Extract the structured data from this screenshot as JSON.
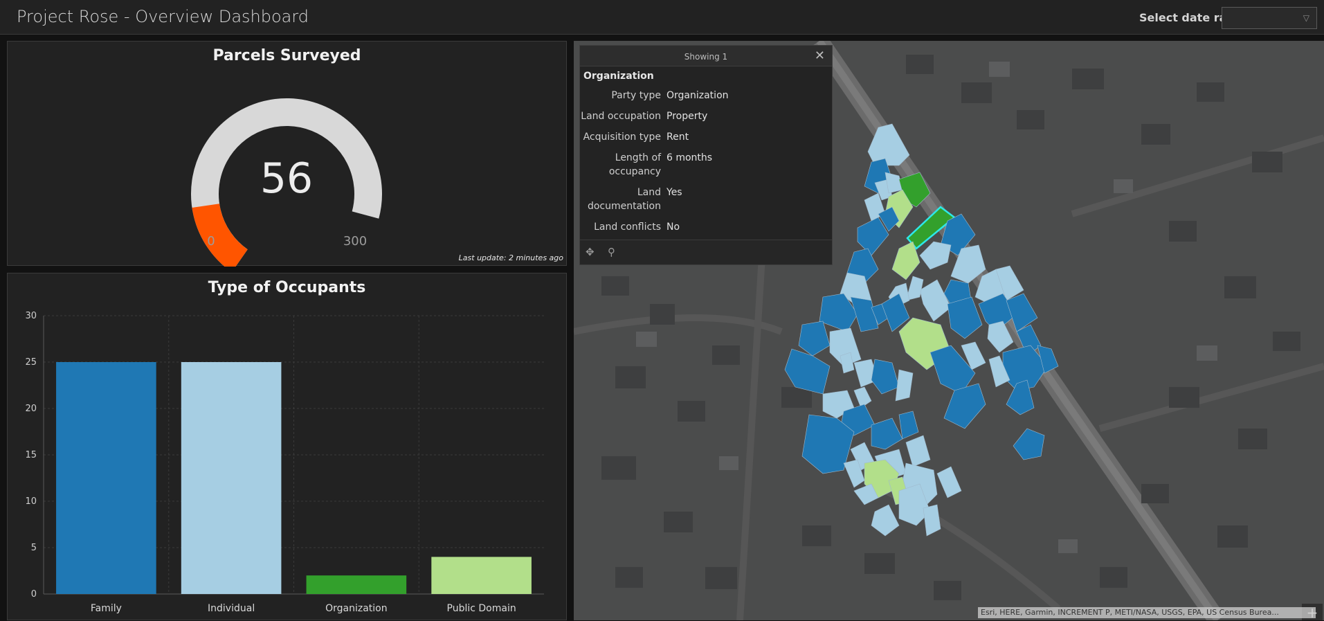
{
  "header": {
    "title": "Project Rose - Overview Dashboard",
    "date_range_label": "Select date range",
    "date_range_value": ""
  },
  "gauge": {
    "title": "Parcels Surveyed",
    "value": 56,
    "min": 0,
    "max": 300,
    "min_label": "0",
    "max_label": "300",
    "value_label": "56",
    "fill_color": "#ff5500",
    "track_color": "#d8d8d8",
    "last_update": "Last update: 2 minutes ago"
  },
  "chart_data": {
    "type": "bar",
    "title": "Type of Occupants",
    "categories": [
      "Family",
      "Individual",
      "Organization",
      "Public Domain"
    ],
    "values": [
      25,
      25,
      2,
      4
    ],
    "colors": [
      "#1f78b4",
      "#a6cee3",
      "#33a02c",
      "#b2df8a"
    ],
    "ylim": [
      0,
      30
    ],
    "yticks": [
      "0",
      "5",
      "10",
      "15",
      "20",
      "25",
      "30"
    ],
    "grid": true
  },
  "popup": {
    "count_label": "Showing 1",
    "title": "Organization",
    "fields": [
      {
        "key": "Party type",
        "value": "Organization"
      },
      {
        "key": "Land occupation",
        "value": "Property"
      },
      {
        "key": "Acquisition type",
        "value": "Rent"
      },
      {
        "key": "Length of occupancy",
        "value": "6 months"
      },
      {
        "key": "Land documentation",
        "value": "Yes"
      },
      {
        "key": "Land conflicts",
        "value": "No"
      }
    ],
    "close_icon": "close-icon",
    "pan_icon": "pan-icon",
    "zoom_icon": "zoom-to-icon"
  },
  "map": {
    "zoom_in": "+",
    "zoom_out": "−",
    "attribution": "Esri, HERE, Garmin, INCREMENT P, METI/NASA, USGS, EPA, US Census Burea..."
  }
}
